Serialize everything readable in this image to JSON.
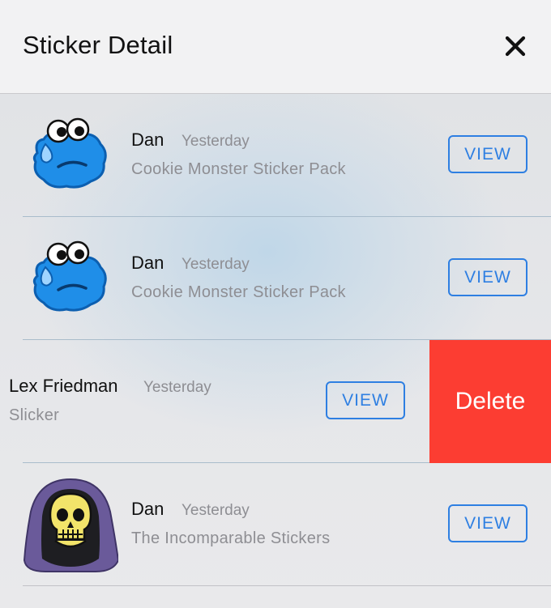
{
  "header": {
    "title": "Sticker Detail",
    "close_icon": "close-icon"
  },
  "rows": [
    {
      "sender": "Dan",
      "time": "Yesterday",
      "pack": "Cookie Monster Sticker Pack",
      "view_label": "VIEW",
      "avatar": "cookie-monster-sticker-icon"
    },
    {
      "sender": "Dan",
      "time": "Yesterday",
      "pack": "Cookie Monster Sticker Pack",
      "view_label": "VIEW",
      "avatar": "cookie-monster-sticker-icon"
    },
    {
      "sender": "Lex Friedman",
      "time": "Yesterday",
      "pack": "Slicker",
      "view_label": "VIEW",
      "delete_label": "Delete"
    },
    {
      "sender": "Dan",
      "time": "Yesterday",
      "pack": "The Incomparable Stickers",
      "view_label": "VIEW",
      "avatar": "skeletor-skull-sticker-icon"
    }
  ],
  "colors": {
    "accent": "#2e7fe2",
    "delete": "#fc3d32",
    "secondary_text": "#8e8e93"
  }
}
